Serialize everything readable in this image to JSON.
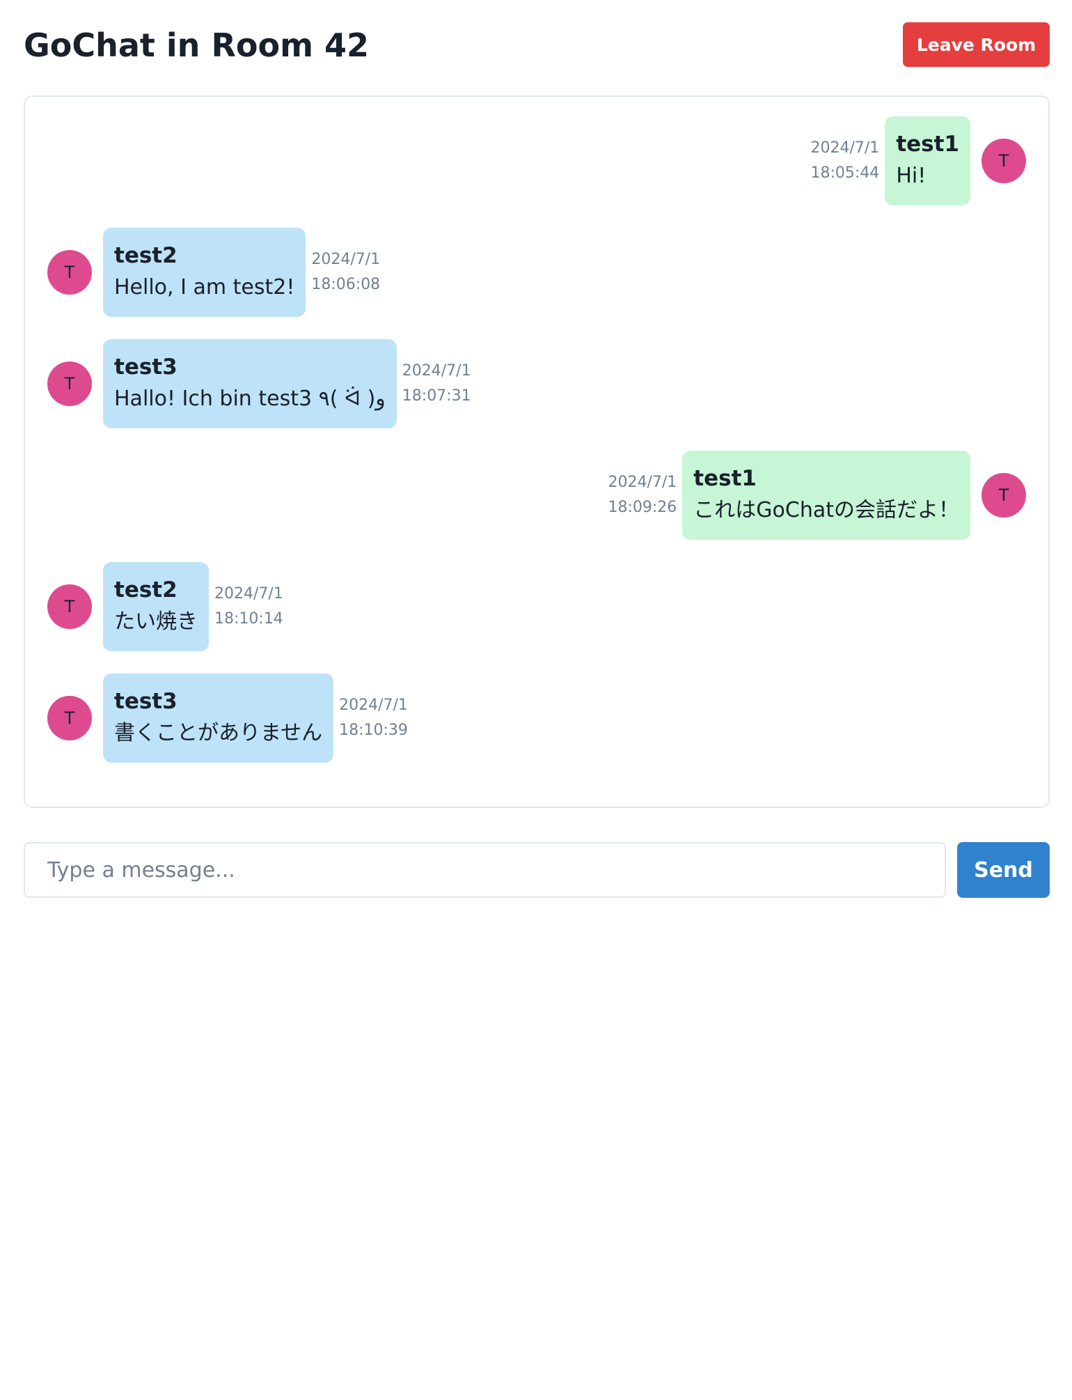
{
  "header": {
    "title": "GoChat in Room 42",
    "leave_label": "Leave Room"
  },
  "messages": [
    {
      "sender": "test1",
      "text": "Hi!",
      "date": "2024/7/1",
      "time": "18:05:44",
      "avatar": "T",
      "is_self": true
    },
    {
      "sender": "test2",
      "text": "Hello, I am test2!",
      "date": "2024/7/1",
      "time": "18:06:08",
      "avatar": "T",
      "is_self": false
    },
    {
      "sender": "test3",
      "text": "Hallo! Ich bin test3 ٩( ᐛ )و",
      "date": "2024/7/1",
      "time": "18:07:31",
      "avatar": "T",
      "is_self": false
    },
    {
      "sender": "test1",
      "text": "これはGoChatの会話だよ！",
      "date": "2024/7/1",
      "time": "18:09:26",
      "avatar": "T",
      "is_self": true
    },
    {
      "sender": "test2",
      "text": "たい焼き",
      "date": "2024/7/1",
      "time": "18:10:14",
      "avatar": "T",
      "is_self": false
    },
    {
      "sender": "test3",
      "text": "書くことがありません",
      "date": "2024/7/1",
      "time": "18:10:39",
      "avatar": "T",
      "is_self": false
    }
  ],
  "composer": {
    "value": "",
    "placeholder": "Type a message...",
    "send_label": "Send"
  },
  "colors": {
    "leave_button": "#e53e3e",
    "send_button": "#3182ce",
    "self_bubble": "#c6f6d5",
    "other_bubble": "#bee3f8",
    "avatar": "#dd4b8e"
  }
}
